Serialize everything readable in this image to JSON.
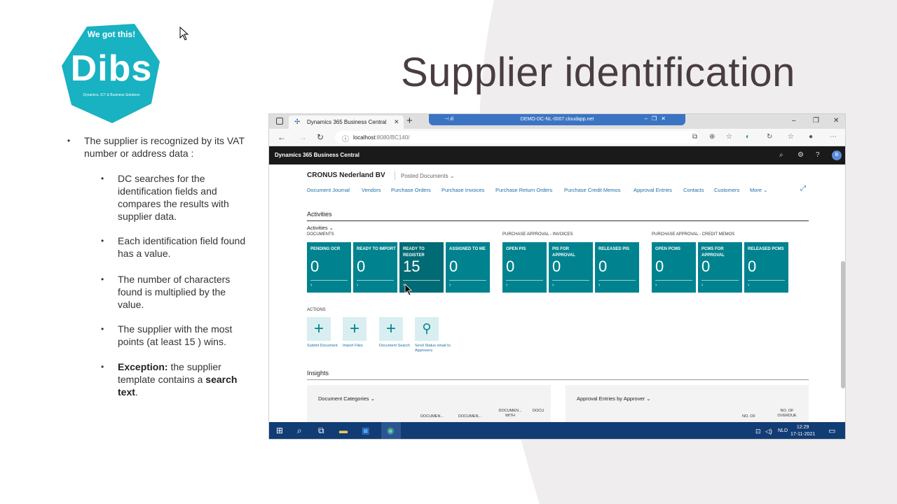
{
  "slide": {
    "title": "Supplier identification",
    "accent_color": "#18b2c2",
    "logo": {
      "tagline": "We got this!",
      "brand": "Dibs",
      "sub": "Dynamics, ICT & Business Solutions"
    },
    "bullets": [
      {
        "text": "The supplier is recognized by its VAT number or address data :"
      },
      {
        "text": "DC searches for the identification fields and compares the results with supplier data."
      },
      {
        "text": "Each identification field found has a value."
      },
      {
        "text": "The number of characters found is multiplied by the value."
      },
      {
        "text": "The supplier with the most points (at least 15 ) wins."
      },
      {
        "exception_bold": "Exception:",
        "exception_mid": " the supplier template contains a ",
        "exception_bold2": "search text",
        "exception_end": "."
      }
    ]
  },
  "browser": {
    "tab_title": "Dynamics 365 Business Central",
    "remote_title": "DEMO-DC-NL-0007.cloudapp.net",
    "url_host": "localhost",
    "url_rest": ":8080/BC140/"
  },
  "bc": {
    "app_title": "Dynamics 365 Business Central",
    "user_initial": "B",
    "company": "CRONUS Nederland BV",
    "posted_documents": "Posted Documents",
    "nav_links": [
      "Document Journal",
      "Vendors",
      "Purchase Orders",
      "Purchase Invoices",
      "Purchase Return Orders",
      "Purchase Credit Memos",
      "Approval Entries",
      "Contacts",
      "Customers",
      "More"
    ],
    "activities_heading": "Activities",
    "activities_dropdown": "Activities",
    "groups": [
      "Documents",
      "Purchase Approval - Invoices",
      "Purchase Approval - Credit Memos"
    ],
    "tiles": [
      {
        "label": "PENDING OCR",
        "value": "0"
      },
      {
        "label": "READY TO IMPORT",
        "value": "0"
      },
      {
        "label": "READY TO REGISTER",
        "value": "15"
      },
      {
        "label": "ASSIGNED TO ME",
        "value": "0"
      },
      {
        "label": "OPEN PIS",
        "value": "0"
      },
      {
        "label": "PIS FOR APPROVAL",
        "value": "0"
      },
      {
        "label": "RELEASED PIS",
        "value": "0"
      },
      {
        "label": "OPEN PCMS",
        "value": "0"
      },
      {
        "label": "PCMS FOR APPROVAL",
        "value": "0"
      },
      {
        "label": "RELEASED PCMS",
        "value": "0"
      }
    ],
    "actions_heading": "ACTIONS",
    "actions": [
      {
        "label": "Submit Document",
        "icon": "plus-icon"
      },
      {
        "label": "Import Files",
        "icon": "plus-icon"
      },
      {
        "label": "Document Search",
        "icon": "plus-icon"
      },
      {
        "label": "Send Status email to Approvers",
        "icon": "person-icon"
      }
    ],
    "insights_heading": "Insights",
    "card1": {
      "title": "Document Categories",
      "cols": [
        "DOCUMEN...",
        "DOCUMEN...",
        "DOCUMEN... WITH",
        "DOCU"
      ]
    },
    "card2": {
      "title": "Approval Entries by Approver",
      "cols": [
        "NO. OF",
        "NO. OF OVERDUE"
      ]
    }
  },
  "taskbar": {
    "lang": "NLD",
    "time": "12:29",
    "date": "17-11-2021"
  }
}
